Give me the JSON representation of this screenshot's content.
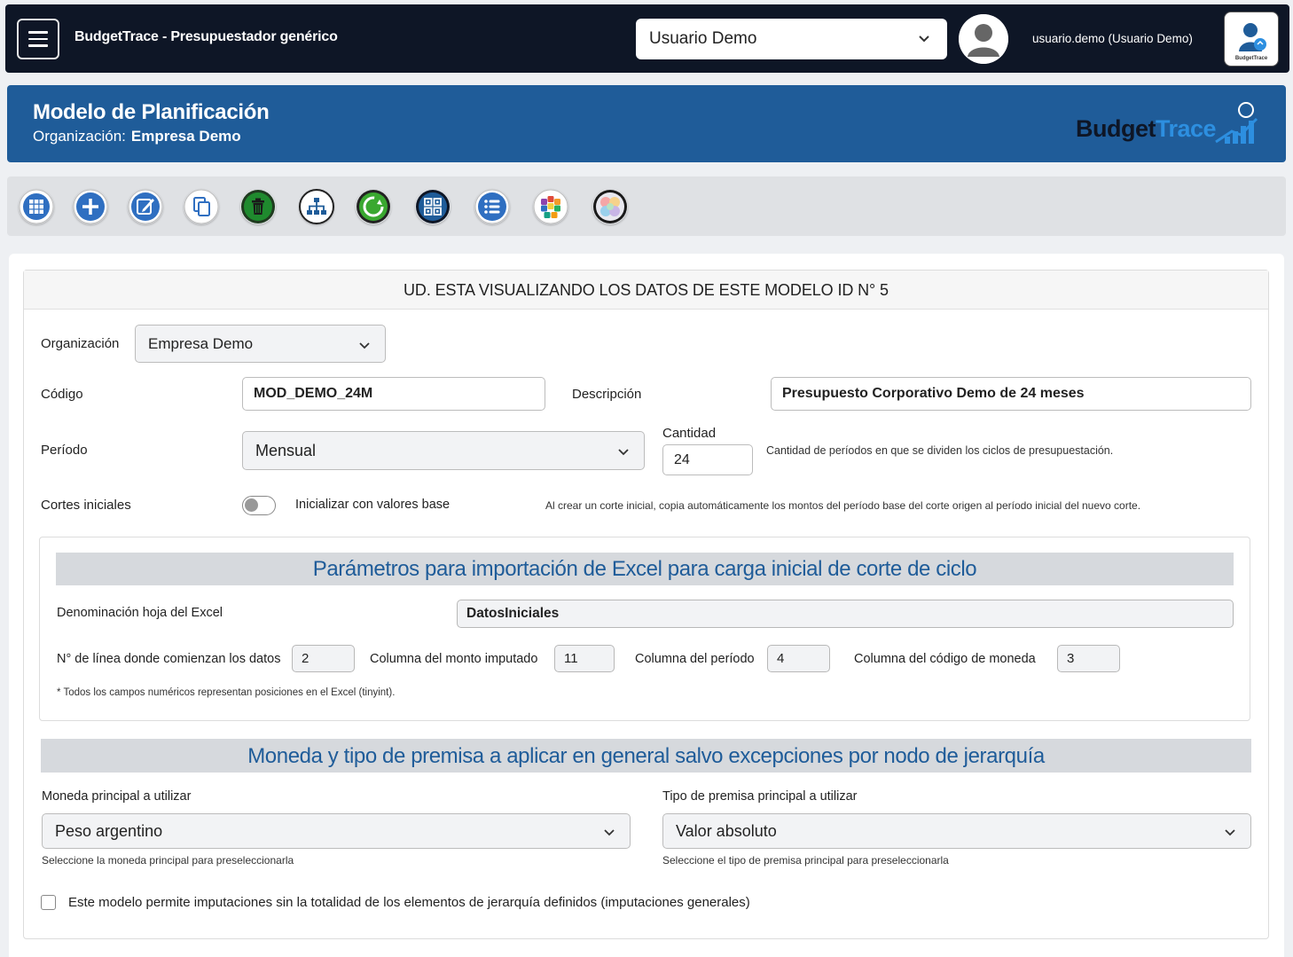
{
  "topbar": {
    "app_title": "BudgetTrace - Presupuestador genérico",
    "user_select_value": "Usuario Demo",
    "user_label": "usuario.demo (Usuario Demo)",
    "profile_logo_text": "BudgetTrace"
  },
  "header": {
    "title": "Modelo de Planificación",
    "org_label": "Organización:",
    "org_value": "Empresa Demo",
    "logo_part1": "Budget",
    "logo_part2": "Trace"
  },
  "toolbar": {
    "buttons": [
      {
        "icon": "grid-view-icon",
        "color": "#2f6fc1"
      },
      {
        "icon": "plus-icon",
        "color": "#2f6fc1"
      },
      {
        "icon": "edit-icon",
        "color": "#2f6fc1"
      },
      {
        "icon": "copy-icon",
        "color": "#2f6fc1"
      },
      {
        "icon": "trash-icon",
        "color": "#1f8a2e"
      },
      {
        "icon": "hierarchy-icon",
        "color": "#1f5c99"
      },
      {
        "icon": "refresh-icon",
        "color": "#3aa830"
      },
      {
        "icon": "qr-grid-icon",
        "color": "#1f5c99"
      },
      {
        "icon": "list-icon",
        "color": "#2f6fc1"
      },
      {
        "icon": "color-tiles-icon",
        "color": "#e04a3a"
      },
      {
        "icon": "palette-icon",
        "color": "#f4a6a6"
      }
    ]
  },
  "card": {
    "heading": "UD. ESTA VISUALIZANDO LOS DATOS DE ESTE MODELO ID N° 5",
    "organizacion_label": "Organización",
    "organizacion_value": "Empresa Demo",
    "codigo_label": "Código",
    "codigo_value": "MOD_DEMO_24M",
    "descripcion_label": "Descripción",
    "descripcion_value": "Presupuesto Corporativo Demo de 24 meses",
    "periodo_label": "Período",
    "periodo_value": "Mensual",
    "cantidad_label": "Cantidad",
    "cantidad_value": "24",
    "cantidad_hint": "Cantidad de períodos en que se dividen los ciclos de presupuestación.",
    "cortes_label": "Cortes iniciales",
    "toggle_label": "Inicializar con valores base",
    "cortes_hint": "Al crear un corte inicial, copia automáticamente los montos del período base del corte origen al período inicial del nuevo corte."
  },
  "excel": {
    "banner": "Parámetros para importación de Excel para carga inicial de corte de ciclo",
    "hoja_label": "Denominación hoja del Excel",
    "hoja_value": "DatosIniciales",
    "linea_label": "N° de línea donde comienzan los datos",
    "linea_value": "2",
    "monto_label": "Columna del monto imputado",
    "monto_value": "11",
    "periodo_label": "Columna del período",
    "periodo_value": "4",
    "moneda_label": "Columna del código de moneda",
    "moneda_value": "3",
    "note": "* Todos los campos numéricos representan posiciones en el Excel (tinyint)."
  },
  "moneda": {
    "banner": "Moneda y tipo de premisa a aplicar en general salvo excepciones por nodo de jerarquía",
    "moneda_label": "Moneda principal a utilizar",
    "moneda_value": "Peso argentino",
    "moneda_hint": "Seleccione la moneda principal para preseleccionarla",
    "premisa_label": "Tipo de premisa principal a utilizar",
    "premisa_value": "Valor absoluto",
    "premisa_hint": "Seleccione el tipo de premisa principal para preseleccionarla",
    "checkbox_label": "Este modelo permite imputaciones sin la totalidad de los elementos de jerarquía definidos (imputaciones generales)"
  }
}
